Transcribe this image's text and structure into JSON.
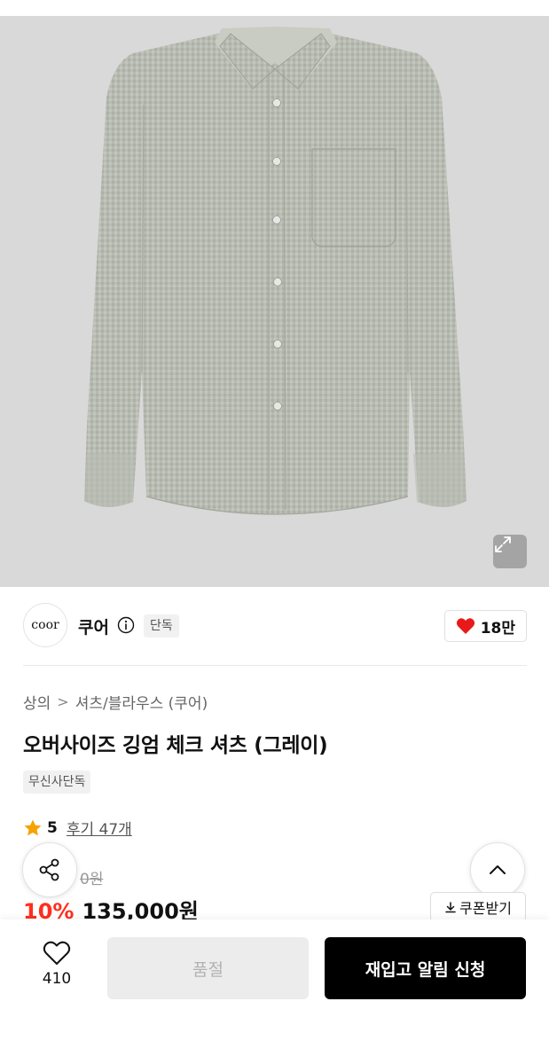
{
  "product_image": {
    "alt": "shirt-product-photo",
    "expand_icon": "expand-icon"
  },
  "brand": {
    "logo_text": "coor",
    "name": "쿠어",
    "info_icon": "info-icon",
    "badge": "단독",
    "likes": "18만",
    "like_icon": "heart-filled-icon"
  },
  "breadcrumb": {
    "items": [
      "상의",
      "셔츠/블라우스 (쿠어)"
    ],
    "separator": ">"
  },
  "product": {
    "title": "오버사이즈 깅엄 체크 셔츠 (그레이)",
    "tag": "무신사단독",
    "rating_score": "5",
    "reviews_label": "후기 47개",
    "original_price_visible": "0원",
    "discount": "10%",
    "price": "135,000원",
    "coupon_label": "쿠폰받기"
  },
  "floating": {
    "share_icon": "share-icon",
    "scroll_top_icon": "chevron-up-icon"
  },
  "bottom_bar": {
    "wish_count": "410",
    "soldout_label": "품절",
    "restock_label": "재입고 알림 신청"
  },
  "colors": {
    "discount_red": "#ff2e1f",
    "heart_red": "#e8191a",
    "star_orange": "#f5a302",
    "primary_black": "#000000",
    "disabled_gray": "#ececec"
  }
}
